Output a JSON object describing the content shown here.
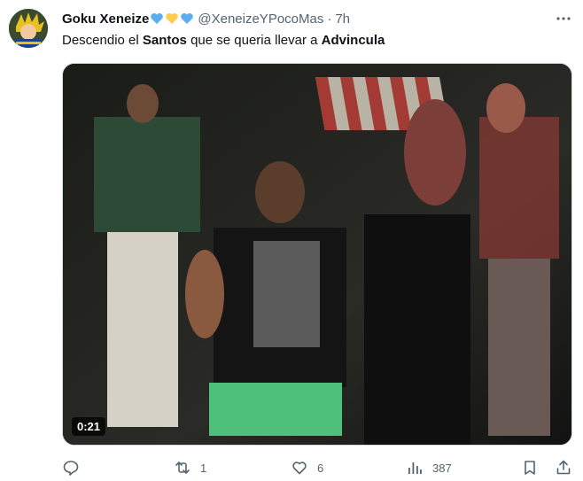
{
  "author": {
    "display_name": "Goku Xeneize",
    "handle": "@XeneizeYPocoMas",
    "separator": "·",
    "time": "7h",
    "emoji_badges": [
      "blue-heart",
      "yellow-heart",
      "blue-heart"
    ]
  },
  "tweet": {
    "text_part1": "Descendio el ",
    "bold1": "Santos",
    "text_part2": " que se queria llevar a ",
    "bold2": "Advincula"
  },
  "media": {
    "type": "video",
    "duration": "0:21"
  },
  "actions": {
    "reply_count": "",
    "retweet_count": "1",
    "like_count": "6",
    "views_count": "387"
  },
  "colors": {
    "secondary_text": "#536471",
    "primary_text": "#0f1419",
    "heart_blue": "#5cadec",
    "heart_yellow": "#ffcc4d"
  }
}
